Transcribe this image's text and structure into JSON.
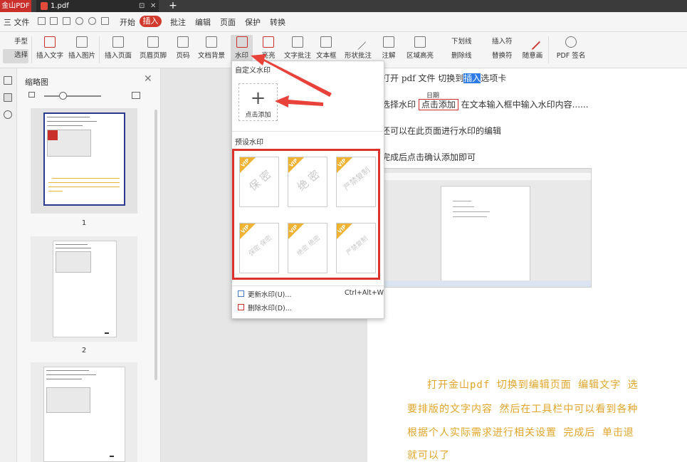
{
  "app": {
    "name": "金山PDF",
    "doc_tab": "1.pdf",
    "tab_pin": "⊡",
    "tab_close": "✕",
    "new_tab": "+"
  },
  "menubar": {
    "file": "三 文件",
    "tabs": [
      "开始",
      "插入",
      "批注",
      "编辑",
      "页面",
      "保护",
      "转换"
    ],
    "active_tab": "插入"
  },
  "toolbar": {
    "hand": "手型",
    "select": "选择",
    "insert_text": "插入文字",
    "insert_image": "插入图片",
    "insert_page": "插入页面",
    "header_footer": "页眉页脚",
    "page_number": "页码",
    "doc_background": "文档背景",
    "watermark": "水印",
    "highlight": "亮亮",
    "text_annotation": "文字批注",
    "textbox": "文本框",
    "shape_annotation": "形状批注",
    "note": "注解",
    "area_highlight": "区域高亮",
    "underline": "下划线",
    "strikethrough": "删除线",
    "insert_mark": "插入符",
    "replace_mark": "替换符",
    "freehand": "随意画",
    "pdf_sign": "PDF 签名"
  },
  "thumbnails": {
    "title": "缩略图",
    "close": "✕",
    "pages": [
      "1",
      "2"
    ]
  },
  "dropdown": {
    "custom_header": "自定义水印",
    "add_label": "点击添加",
    "add_plus": "+",
    "preset_header": "预设水印",
    "presets": [
      {
        "badge": "VIP",
        "text": "保 密"
      },
      {
        "badge": "VIP",
        "text": "绝 密"
      },
      {
        "badge": "VIP",
        "text": "严禁复制"
      },
      {
        "badge": "VIP",
        "text": "保密 保密"
      },
      {
        "badge": "VIP",
        "text": "绝密 绝密"
      },
      {
        "badge": "VIP",
        "text": "严禁复制"
      }
    ],
    "update": "更新水印(U)...",
    "update_shortcut": "Ctrl+Alt+W",
    "delete": "删除水印(D)..."
  },
  "document": {
    "line1_a": "打开 pdf 文件   切换到",
    "line1_hl": "插入",
    "line1_b": "选项卡",
    "line2_a": "选择水印  ",
    "line2_box": "点击添加",
    "line2_date": "日期",
    "line2_b": "  在文本输入框中输入水印内容......",
    "line3": "还可以在此页面进行水印的编辑",
    "line4": "完成后点击确认添加即可",
    "yellow": [
      "打开金山pdf  切换到编辑页面  编辑文字  选",
      "要排版的文字内容  然后在工具栏中可以看到各种",
      "根据个人实际需求进行相关设置  完成后  单击退",
      "就可以了"
    ]
  },
  "colors": {
    "accent": "#d23a2d",
    "highlight": "#2d7be5",
    "yellow_text": "#e0a52a",
    "vip": "#f0b233"
  }
}
